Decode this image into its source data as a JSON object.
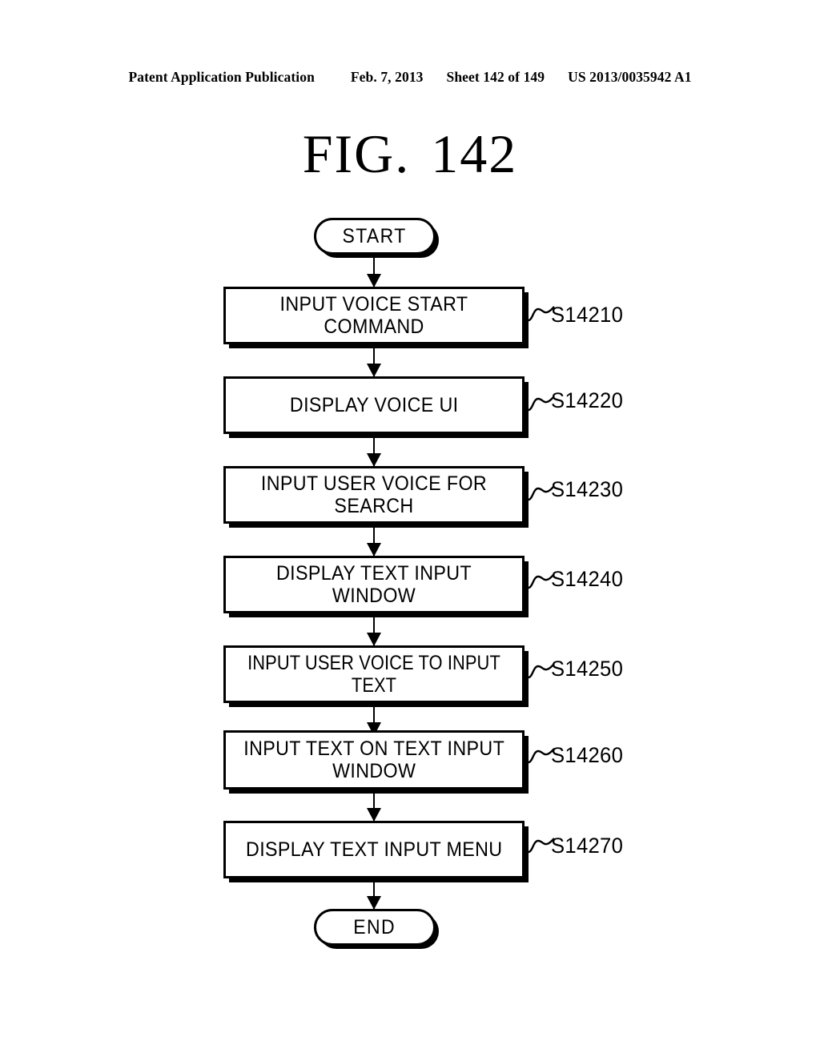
{
  "header": {
    "publication": "Patent Application Publication",
    "date": "Feb. 7, 2013",
    "sheet": "Sheet 142 of 149",
    "patent_number": "US 2013/0035942 A1"
  },
  "figure": {
    "prefix": "FIG.",
    "number": "142"
  },
  "flowchart": {
    "type": "flowchart",
    "orientation": "vertical",
    "start_label": "START",
    "end_label": "END",
    "steps": [
      {
        "text": "INPUT VOICE START COMMAND",
        "ref": "S14210",
        "lines": 1
      },
      {
        "text": "DISPLAY VOICE UI",
        "ref": "S14220",
        "lines": 1
      },
      {
        "text": "INPUT USER VOICE FOR SEARCH",
        "ref": "S14230",
        "lines": 1
      },
      {
        "text": "DISPLAY TEXT INPUT WINDOW",
        "ref": "S14240",
        "lines": 1
      },
      {
        "text": "INPUT USER VOICE TO INPUT TEXT",
        "ref": "S14250",
        "lines": 1
      },
      {
        "text": "INPUT TEXT ON TEXT INPUT\nWINDOW",
        "ref": "S14260",
        "lines": 2
      },
      {
        "text": "DISPLAY TEXT INPUT MENU",
        "ref": "S14270",
        "lines": 1
      }
    ]
  },
  "colors": {
    "ink": "#000000",
    "paper": "#ffffff"
  }
}
